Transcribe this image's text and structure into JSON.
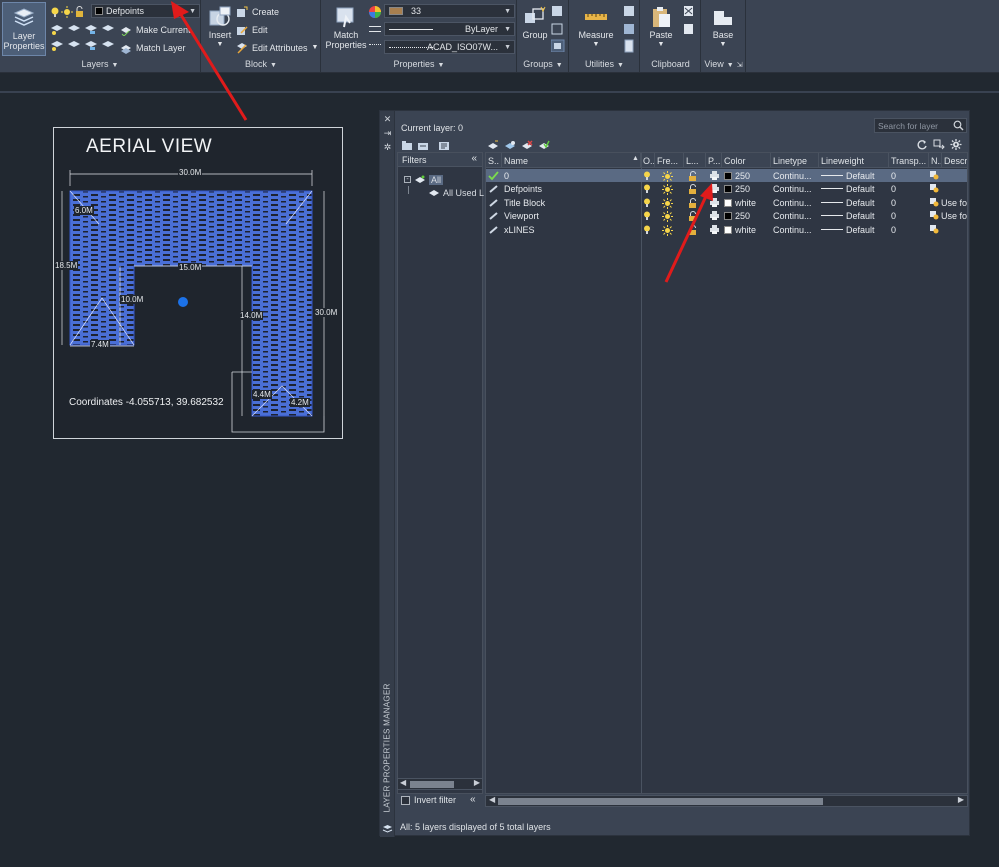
{
  "ribbon": {
    "layers": {
      "big_button": "Layer Properties",
      "layer_combo": "Defpoints",
      "make_current": "Make Current",
      "match_layer": "Match Layer",
      "title": "Layers"
    },
    "block": {
      "insert": "Insert",
      "create": "Create",
      "edit": "Edit",
      "edit_attributes": "Edit Attributes",
      "title": "Block"
    },
    "properties": {
      "match": "Match Properties",
      "color_value": "33",
      "linetype_value": "ByLayer",
      "lineweight_value": "ACAD_ISO07W...",
      "title": "Properties"
    },
    "groups": {
      "group": "Group",
      "title": "Groups"
    },
    "utilities": {
      "measure": "Measure",
      "title": "Utilities"
    },
    "clipboard": {
      "paste": "Paste",
      "title": "Clipboard"
    },
    "view": {
      "base": "Base",
      "title": "View"
    }
  },
  "drawing": {
    "title": "AERIAL VIEW",
    "coordinates": "Coordinates -4.055713, 39.682532",
    "dims": {
      "top": "30.0M",
      "left_short": "6.0M",
      "left": "18.5M",
      "inner_top": "15.0M",
      "inner_left": "10.0M",
      "bottom_left": "7.4M",
      "inner_right": "14.0M",
      "right": "30.0M",
      "small_a": "4.4M",
      "small_b": "4.2M"
    }
  },
  "layer_manager": {
    "side_title": "LAYER PROPERTIES MANAGER",
    "current_layer": "Current layer: 0",
    "search_placeholder": "Search for layer",
    "filters_label": "Filters",
    "filter_tree": [
      "All",
      "All Used L"
    ],
    "columns": [
      "S..",
      "Name",
      "O..",
      "Fre...",
      "L...",
      "P...",
      "Color",
      "Linetype",
      "Lineweight",
      "Transp...",
      "N..",
      "Descrip"
    ],
    "layers": [
      {
        "name": "0",
        "color": "250",
        "color_hex": "#000000",
        "linetype": "Continu...",
        "lineweight": "Default",
        "transparency": "0",
        "description": "",
        "current": true,
        "selected": true
      },
      {
        "name": "Defpoints",
        "color": "250",
        "color_hex": "#000000",
        "linetype": "Continu...",
        "lineweight": "Default",
        "transparency": "0",
        "description": "",
        "current": false,
        "selected": false
      },
      {
        "name": "Title Block",
        "color": "white",
        "color_hex": "#ffffff",
        "linetype": "Continu...",
        "lineweight": "Default",
        "transparency": "0",
        "description": "Use for",
        "current": false,
        "selected": false
      },
      {
        "name": "Viewport",
        "color": "250",
        "color_hex": "#000000",
        "linetype": "Continu...",
        "lineweight": "Default",
        "transparency": "0",
        "description": "Use for",
        "current": false,
        "selected": false
      },
      {
        "name": "xLINES",
        "color": "white",
        "color_hex": "#ffffff",
        "linetype": "Continu...",
        "lineweight": "Default",
        "transparency": "0",
        "description": "",
        "current": false,
        "selected": false
      }
    ],
    "invert_filter": "Invert filter",
    "status": "All: 5 layers displayed of 5 total layers"
  },
  "colors": {
    "annotation_arrow": "#e01b1b",
    "hatch_blue": "#4a6fd6",
    "ribbon_bg": "#3b4453",
    "canvas_bg": "#212830"
  }
}
